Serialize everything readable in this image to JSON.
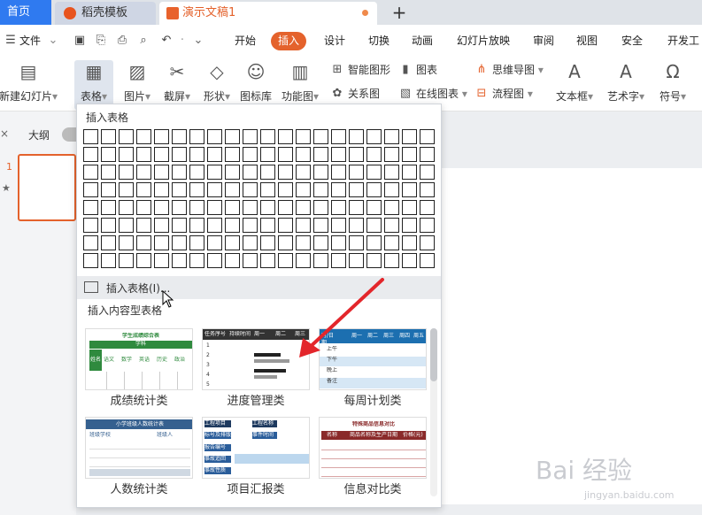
{
  "tabs": {
    "home": "首页",
    "daoke": "稻壳模板",
    "doc": "演示文稿1",
    "plus": "+"
  },
  "menubar": {
    "file": "文件",
    "items": [
      "开始",
      "插入",
      "设计",
      "切换",
      "动画",
      "幻灯片放映",
      "审阅",
      "视图",
      "安全",
      "开发工"
    ],
    "active": "插入"
  },
  "ribbon": {
    "new_slide": "新建幻灯片",
    "table": "表格",
    "picture": "图片",
    "screenshot": "截屏",
    "shape": "形状",
    "icon_lib": "图标库",
    "func_chart": "功能图",
    "smart_art": "智能图形",
    "chart": "图表",
    "relation": "关系图",
    "online_chart": "在线图表",
    "mind_map": "思维导图",
    "flowchart": "流程图",
    "textbox": "文本框",
    "art_text": "艺术字",
    "symbol": "符号"
  },
  "left_panel": {
    "outline": "大纲",
    "slide_number": "1"
  },
  "dropdown": {
    "title": "插入表格",
    "grid_cols": 20,
    "grid_rows": 8,
    "insert_table": "插入表格(I)...",
    "section": "插入内容型表格",
    "templates": [
      "成绩统计类",
      "进度管理类",
      "每周计划类",
      "人数统计类",
      "项目汇报类",
      "信息对比类"
    ]
  },
  "thumbs": {
    "grade_title": "学生成绩综合表",
    "grade_sub": "学科",
    "grade_cols": [
      "姓名",
      "语文",
      "数学",
      "英语",
      "历史",
      "政治"
    ],
    "progress_cols": [
      "任务序号",
      "持续时间",
      "周一",
      "周二",
      "周三"
    ],
    "progress_rows": [
      "1",
      "2",
      "3",
      "4",
      "5"
    ],
    "weekly_cols": [
      "时/日期",
      "周一",
      "周二",
      "周三",
      "周四",
      "周五"
    ],
    "weekly_rows": [
      "上午",
      "下午",
      "晚上",
      "备注"
    ],
    "people_title": "小学班级人数统计表",
    "people_cols": [
      "班级学校",
      "班级人"
    ],
    "report_labels": [
      "工程项目",
      "工程名称",
      "标号及排版",
      "事件时间",
      "报告编号",
      "事故追回",
      "事故性质"
    ],
    "compare_title": "特殊商品信息对比",
    "compare_cols": [
      "名称",
      "商品名称及生产日期",
      "价格(元)"
    ]
  },
  "watermark": {
    "main": "Bai 经验",
    "sub": "jingyan.baidu.com"
  },
  "colors": {
    "accent": "#e4622c",
    "brand_blue": "#2f7af0",
    "arrow": "#e3262b"
  }
}
